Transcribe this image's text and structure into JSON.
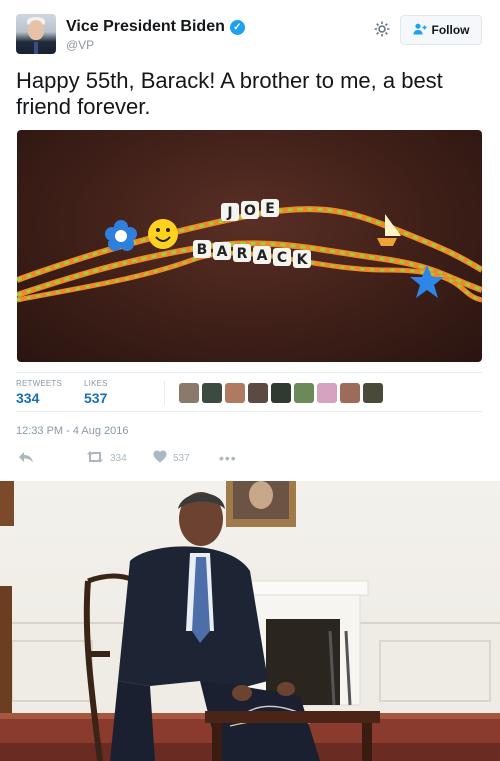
{
  "tweet": {
    "display_name": "Vice President Biden",
    "handle": "@VP",
    "follow_label": "Follow",
    "text": "Happy 55th, Barack! A brother to me, a best friend forever.",
    "media": {
      "bead_words": [
        "JOE",
        "BARACK"
      ]
    },
    "stats": {
      "retweets_label": "RETWEETS",
      "retweets_value": "334",
      "likes_label": "LIKES",
      "likes_value": "537",
      "liker_count": 9
    },
    "timestamp": "12:33 PM - 4 Aug 2016",
    "actions": {
      "retweet_count": "334",
      "like_count": "537"
    }
  },
  "icons": [
    "verified-badge-icon",
    "gear-icon",
    "follow-person-icon",
    "reply-icon",
    "retweet-icon",
    "heart-icon",
    "more-icon"
  ],
  "colors": {
    "accent": "#1da1f2",
    "stat_value": "#1b6fb5",
    "muted": "#8899a6"
  }
}
